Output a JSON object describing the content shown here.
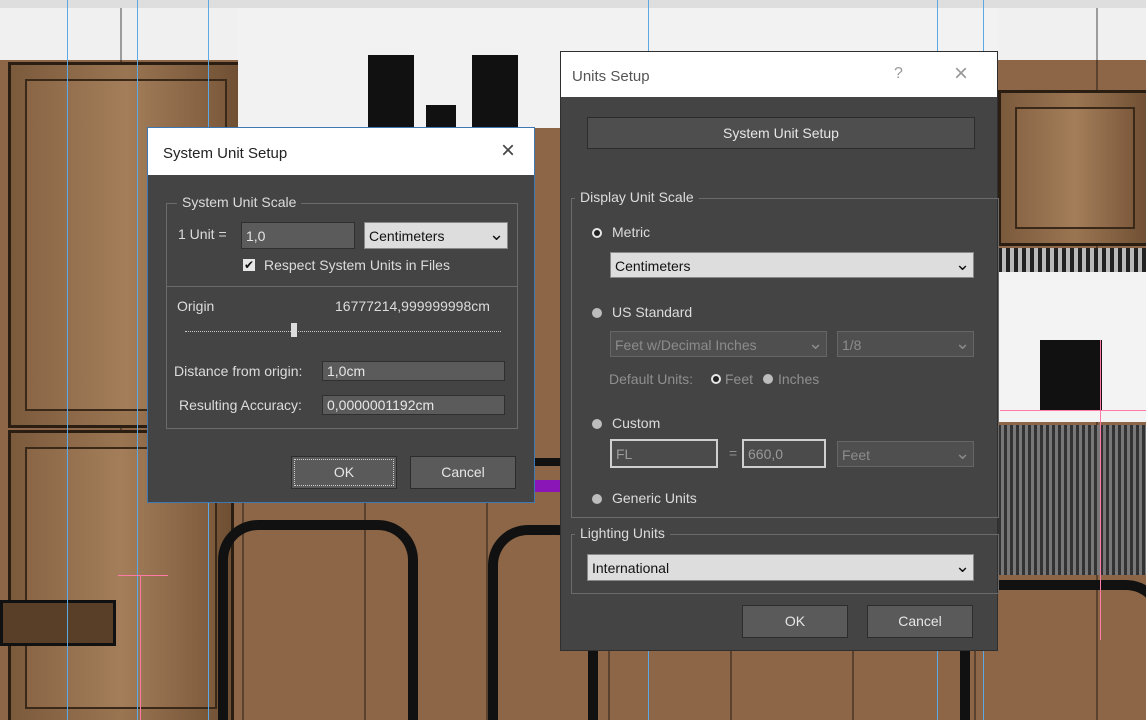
{
  "icons": {
    "close": "×",
    "help": "?",
    "dropdown": "⌄",
    "check": "✔"
  },
  "colors": {
    "dialog_bg": "#444444",
    "title_bar": "#ffffff",
    "accent_purple": "#8a16b8",
    "guide_blue": "#5aa9e6",
    "guide_pink": "#ff7aa6"
  },
  "system_unit_setup": {
    "title": "System Unit Setup",
    "scale_group": "System Unit Scale",
    "unit_label": "1 Unit =",
    "unit_value": "1,0",
    "unit_type": "Centimeters",
    "respect_label": "Respect System Units in Files",
    "respect_checked": true,
    "origin_label": "Origin",
    "origin_value": "16777214,999999998cm",
    "origin_slider_position": 0.34,
    "distance_label": "Distance from origin:",
    "distance_value": "1,0cm",
    "accuracy_label": "Resulting Accuracy:",
    "accuracy_value": "0,0000001192cm",
    "ok": "OK",
    "cancel": "Cancel"
  },
  "units_setup": {
    "title": "Units Setup",
    "system_unit_button": "System Unit Setup",
    "display_group": "Display Unit Scale",
    "metric_label": "Metric",
    "metric_value": "Centimeters",
    "us_label": "US Standard",
    "us_value": "Feet w/Decimal Inches",
    "us_fraction": "1/8",
    "default_units_label": "Default Units:",
    "feet_label": "Feet",
    "inches_label": "Inches",
    "custom_label": "Custom",
    "custom_name": "FL",
    "custom_eq": "=",
    "custom_value": "660,0",
    "custom_unit": "Feet",
    "generic_label": "Generic Units",
    "selected_display": "Metric",
    "lighting_group": "Lighting Units",
    "lighting_value": "International",
    "ok": "OK",
    "cancel": "Cancel"
  }
}
